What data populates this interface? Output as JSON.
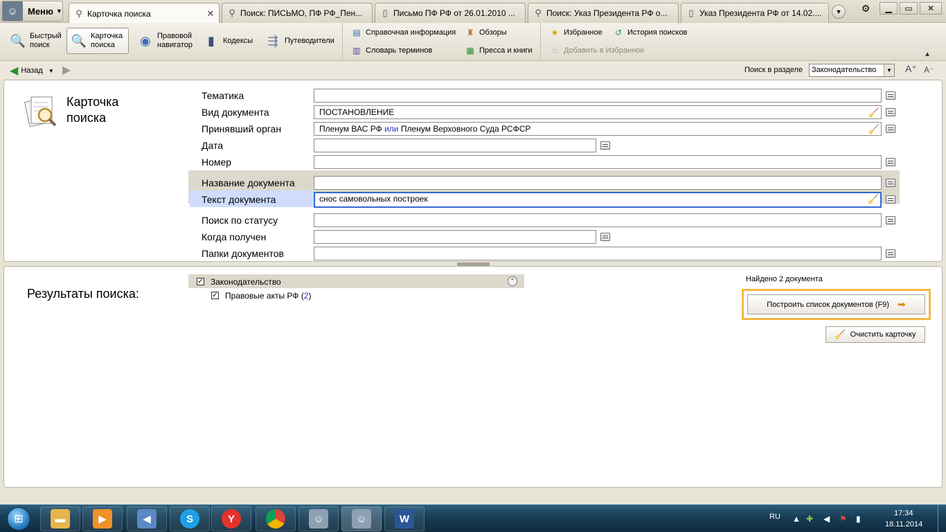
{
  "app": {
    "menu_label": "Меню"
  },
  "tabs": [
    {
      "label": "Карточка поиска",
      "icon": "search-icon",
      "active": true
    },
    {
      "label": "Поиск: ПИСЬМО, ПФ РФ_Пен...",
      "icon": "search-icon",
      "active": false
    },
    {
      "label": "Письмо ПФ РФ от 26.01.2010 ...",
      "icon": "document-icon",
      "active": false
    },
    {
      "label": "Поиск: Указ Президента РФ о...",
      "icon": "search-icon",
      "active": false
    },
    {
      "label": "Указ Президента РФ от 14.02....",
      "icon": "document-icon",
      "active": false
    }
  ],
  "toolbar": {
    "quick_search": "Быстрый\nпоиск",
    "search_card": "Карточка\nпоиска",
    "legal_navigator": "Правовой\nнавигатор",
    "codes": "Кодексы",
    "guides": "Путеводители",
    "reference": "Справочная информация",
    "reviews": "Обзоры",
    "glossary": "Словарь терминов",
    "press": "Пресса и книги",
    "favorites": "Избранное",
    "history": "История поисков",
    "add_favorites": "Добавить в Избранное"
  },
  "nav": {
    "back_label": "Назад",
    "section_label": "Поиск в разделе",
    "section_value": "Законодательство"
  },
  "card": {
    "title": "Карточка\nпоиска",
    "fields": {
      "topic": {
        "label": "Тематика",
        "value": ""
      },
      "doc_type": {
        "label": "Вид документа",
        "value": "ПОСТАНОВЛЕНИЕ"
      },
      "authority": {
        "label": "Принявший орган",
        "value_a": "Пленум ВАС РФ",
        "value_or": "или",
        "value_b": "Пленум Верховного Суда РСФСР"
      },
      "date": {
        "label": "Дата",
        "value": ""
      },
      "number": {
        "label": "Номер",
        "value": ""
      },
      "doc_name": {
        "label": "Название документа",
        "value": ""
      },
      "doc_text": {
        "label": "Текст документа",
        "value": "снос самовольных построек"
      },
      "status": {
        "label": "Поиск по статусу",
        "value": ""
      },
      "received": {
        "label": "Когда получен",
        "value": ""
      },
      "folders": {
        "label": "Папки документов",
        "value": ""
      }
    }
  },
  "results": {
    "title": "Результаты поиска:",
    "section_name": "Законодательство",
    "subsection_name": "Правовые акты РФ",
    "subsection_count_open": "(",
    "subsection_count": "2",
    "subsection_count_close": ")",
    "found_text": "Найдено 2 документа",
    "build_button": "Построить список документов (F9)",
    "clear_button": "Очистить карточку"
  },
  "taskbar": {
    "language": "RU",
    "time": "17:34",
    "date": "18.11.2014"
  },
  "colors": {
    "accent_orange": "#f4b843",
    "focus_blue": "#3667d3",
    "link_blue": "#1e37c0",
    "label_highlight": "#cfdcfb"
  }
}
